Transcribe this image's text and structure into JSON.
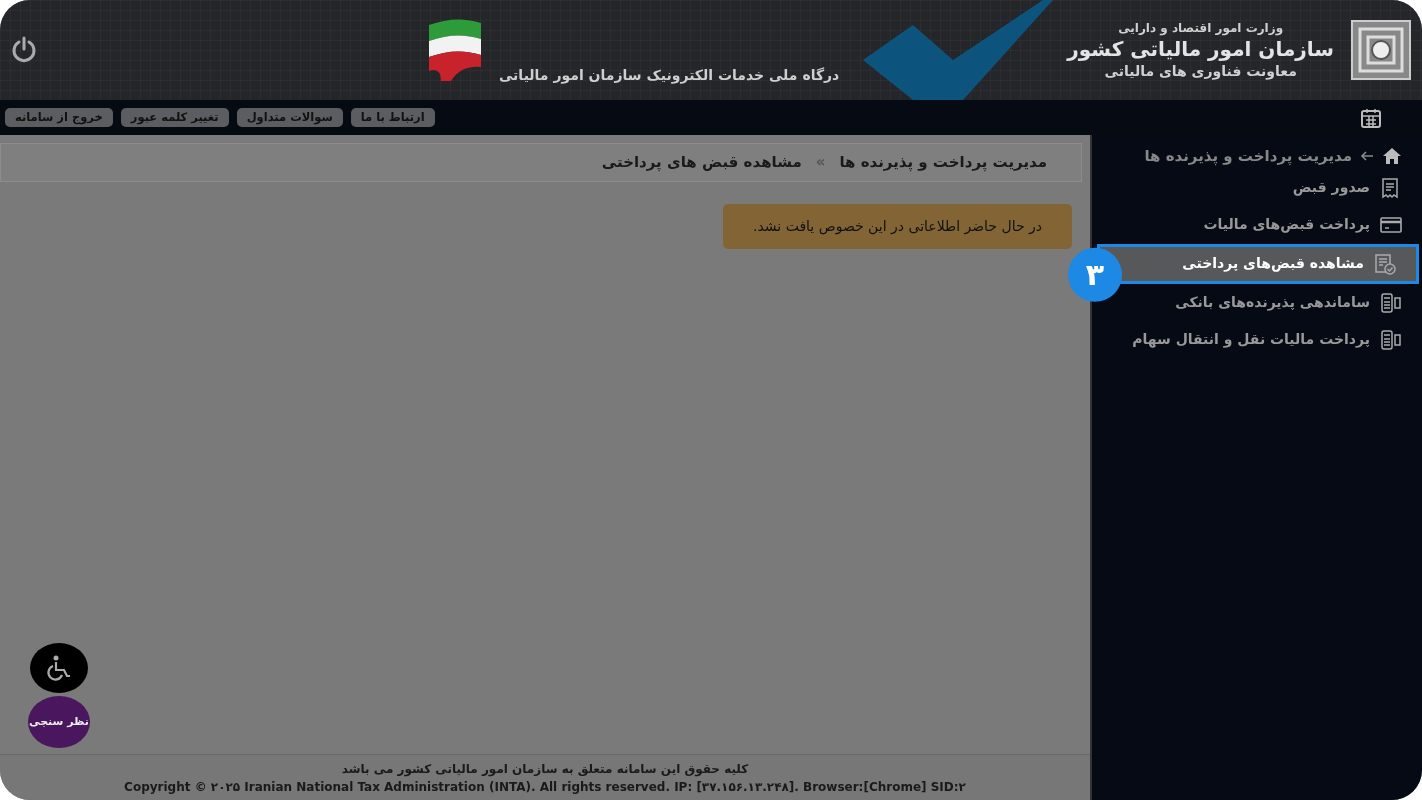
{
  "header": {
    "ministry": "وزارت امور اقتصاد و دارایی",
    "organization": "سازمان امور مالیاتی کشور",
    "deputy": "معاونت فناوری های مالیاتی",
    "portal": "درگاه ملی خدمات الکترونیک سازمان امور مالیاتی"
  },
  "top_links": [
    {
      "label": "ارتباط با ما"
    },
    {
      "label": "سوالات متداول"
    },
    {
      "label": "تغییر کلمه عبور"
    },
    {
      "label": "خروج از سامانه"
    }
  ],
  "sidebar": {
    "title": "مدیریت پرداخت و پذیرنده ها",
    "items": [
      {
        "label": "صدور قبض",
        "kind": "receipt",
        "selected": false
      },
      {
        "label": "پرداخت قبض‌های مالیات",
        "kind": "card",
        "selected": false
      },
      {
        "label": "مشاهده قبض‌های پرداختی",
        "kind": "receipt-check",
        "selected": true,
        "step": "۳"
      },
      {
        "label": "ساماندهی پذیرنده‌های بانکی",
        "kind": "pos",
        "selected": false
      },
      {
        "label": "پرداخت مالیات نقل و انتقال سهام",
        "kind": "pos",
        "selected": false
      }
    ]
  },
  "breadcrumb": {
    "items": [
      "مدیریت پرداخت و پذیرنده ها",
      "مشاهده قبض های پرداختی"
    ],
    "separator": "»"
  },
  "alert": "در حال حاضر اطلاعاتی در این خصوص یافت نشد.",
  "survey_button": "نظر سنجی",
  "footer": {
    "rights": "کلیه حقوق این سامانه متعلق به سازمان امور مالیاتی کشور می باشد",
    "copyright": "Copyright © ۲۰۲۵ Iranian National Tax Administration (INTA). All rights reserved. IP: [۳۷.۱۵۶.۱۳.۲۴۸]. Browser:[Chrome] SID:۲"
  }
}
